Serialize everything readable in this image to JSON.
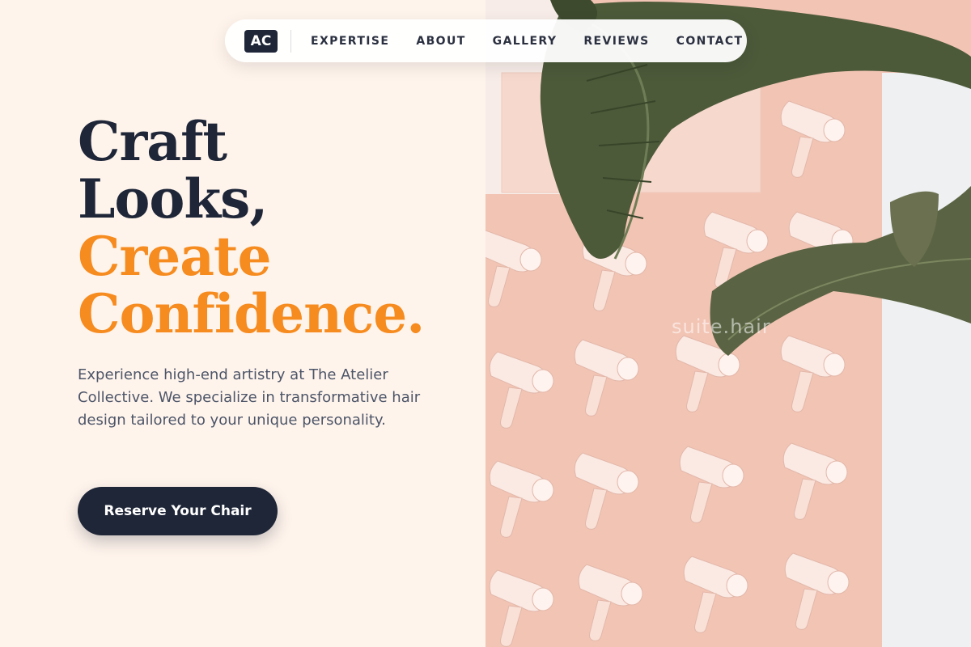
{
  "nav": {
    "logo": "AC",
    "links": [
      "EXPERTISE",
      "ABOUT",
      "GALLERY",
      "REVIEWS",
      "CONTACT"
    ]
  },
  "hero": {
    "headline_line1": "Craft",
    "headline_line2": "Looks,",
    "headline_line3": "Create",
    "headline_line4": "Confidence.",
    "description": "Experience high-end artistry at The Atelier Collective. We specialize in transformative hair design tailored to your unique personality.",
    "cta_label": "Reserve Your Chair",
    "watermark": "suite.hair"
  },
  "colors": {
    "navy": "#1e2638",
    "accent_orange": "#f68b1f",
    "cream_background": "#fff4ec",
    "wall_pink": "#f2c4b4"
  },
  "image": {
    "subject": "pink wall with rows of hair dryers and palm leaves",
    "icons": [
      "hair-dryer-icon",
      "palm-leaf-icon"
    ]
  }
}
